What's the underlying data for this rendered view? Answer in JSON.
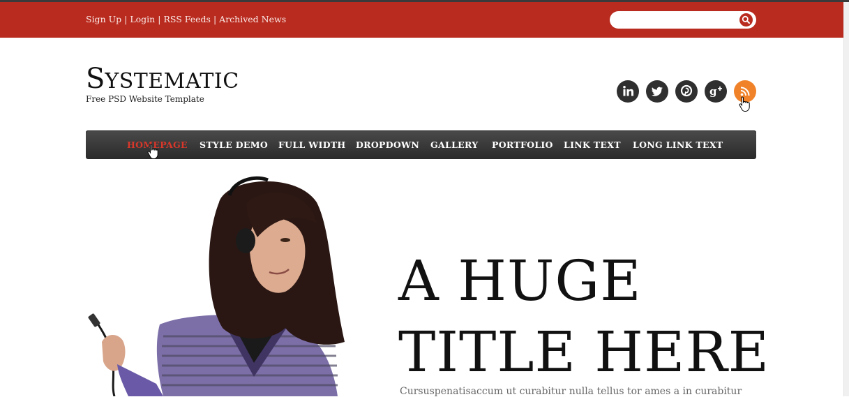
{
  "topbar": {
    "links": [
      "Sign Up",
      "Login",
      "RSS Feeds",
      "Archived News"
    ],
    "separator": "|",
    "search_placeholder": ""
  },
  "brand": {
    "logo_initial": "S",
    "logo_rest": "YSTEMATIC",
    "tagline": "Free PSD Website Template"
  },
  "social": [
    "linkedin-icon",
    "twitter-icon",
    "pinterest-icon",
    "google-plus-icon",
    "rss-icon"
  ],
  "nav": {
    "items": [
      "HOMEPAGE",
      "STYLE DEMO",
      "FULL WIDTH",
      "DROPDOWN",
      "GALLERY",
      "PORTFOLIO",
      "LINK TEXT",
      "LONG LINK TEXT"
    ],
    "active_index": 0
  },
  "hero": {
    "title_line1": "A HUGE",
    "title_line2": "TITLE HERE",
    "body": "Cursuspenatisaccum ut curabitur nulla tellus tor ames a in curabitur"
  },
  "colors": {
    "brand_red": "#b92b1f",
    "nav_dark": "#2f2f2f",
    "rss_orange": "#f0832a",
    "active_nav": "#d9372a"
  }
}
